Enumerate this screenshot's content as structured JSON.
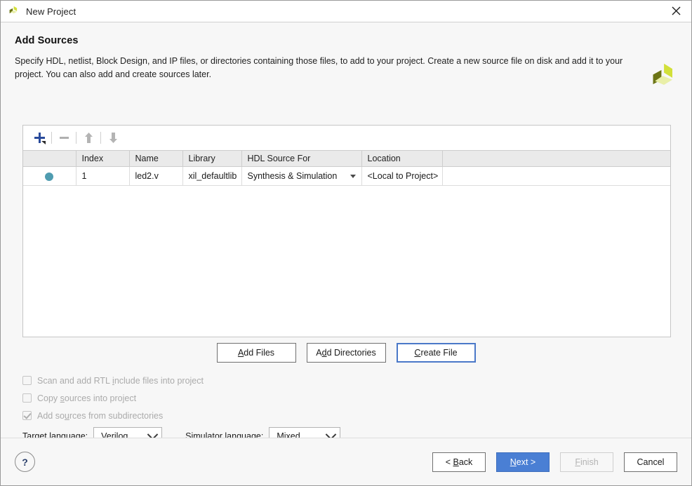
{
  "window": {
    "title": "New Project",
    "icon": "xilinx-logo-icon",
    "close_label": "×"
  },
  "page": {
    "heading": "Add Sources",
    "description": "Specify HDL, netlist, Block Design, and IP files, or directories containing those files, to add to your project. Create a new source file on disk and add it to your project. You can also add and create sources later.",
    "brand_logo": "xilinx-logo"
  },
  "toolbar": {
    "add_icon": "plus-icon",
    "remove_icon": "minus-icon",
    "move_up_icon": "arrow-up-icon",
    "move_down_icon": "arrow-down-icon"
  },
  "table": {
    "columns": [
      "",
      "Index",
      "Name",
      "Library",
      "HDL Source For",
      "Location",
      ""
    ],
    "rows": [
      {
        "status": "active",
        "index": "1",
        "name": "led2.v",
        "library": "xil_defaultlib",
        "hdl_source_for": "Synthesis & Simulation",
        "location": "<Local to Project>"
      }
    ]
  },
  "actions": {
    "add_files": {
      "label": "Add Files",
      "mnemonic_index": 0
    },
    "add_directories": {
      "label": "Add Directories",
      "mnemonic_index": 1
    },
    "create_file": {
      "label": "Create File",
      "mnemonic_index": 0,
      "focused": true
    }
  },
  "options": [
    {
      "label": "Scan and add RTL include files into project",
      "checked": false,
      "enabled": false
    },
    {
      "label": "Copy sources into project",
      "checked": false,
      "enabled": false
    },
    {
      "label": "Add sources from subdirectories",
      "checked": true,
      "enabled": false
    }
  ],
  "languages": {
    "target_label": "Target language:",
    "target_value": "Verilog",
    "simulator_label": "Simulator language:",
    "simulator_value": "Mixed"
  },
  "footer": {
    "help_label": "?",
    "back_label": "< Back",
    "next_label": "Next >",
    "finish_label": "Finish",
    "cancel_label": "Cancel"
  },
  "colors": {
    "accent_blue": "#4a7fd4",
    "focus_blue": "#4a78c8",
    "row_dot": "#4f9cb0",
    "plus_blue": "#2a4b9b",
    "logo_dark": "#6b7414",
    "logo_bright": "#d2e03a",
    "logo_pale": "#e9efa8"
  }
}
